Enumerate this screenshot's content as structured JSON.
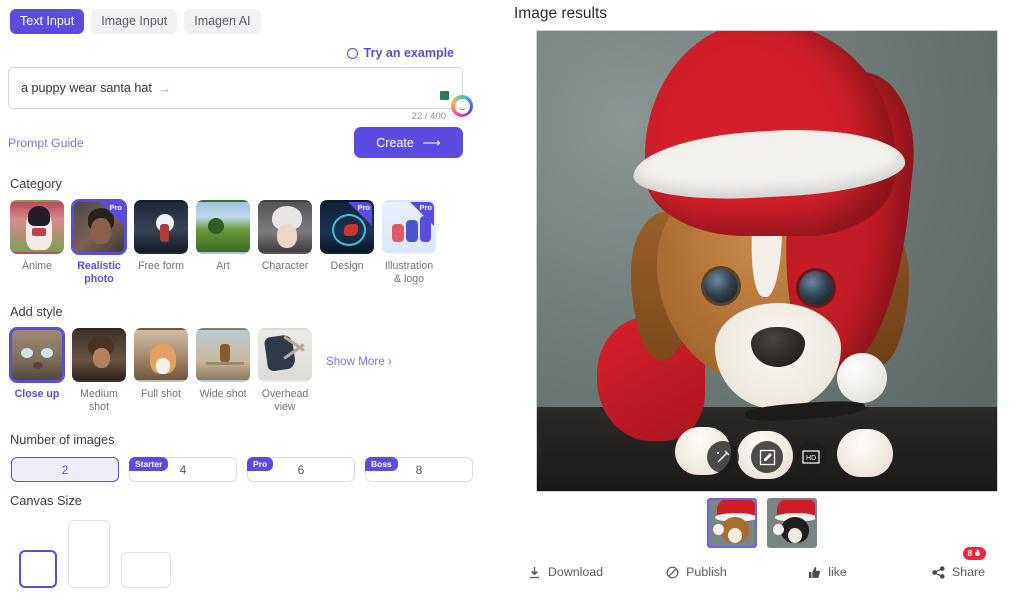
{
  "tabs": [
    {
      "label": "Text Input",
      "active": true
    },
    {
      "label": "Image Input",
      "active": false
    },
    {
      "label": "Imagen AI",
      "active": false
    }
  ],
  "prompt": {
    "try_example": "Try an example",
    "try_example_icon": "refresh-circle-icon",
    "value": "a puppy wear santa hat",
    "arrow": "→",
    "counter": "22 / 400",
    "guide_link": "Prompt Guide",
    "create_label": "Create",
    "create_arrow": "⟶"
  },
  "category": {
    "title": "Category",
    "items": [
      {
        "label": "Anime",
        "pro": false,
        "selected": false
      },
      {
        "label": "Realistic photo",
        "pro": true,
        "selected": true
      },
      {
        "label": "Free form",
        "pro": false,
        "selected": false
      },
      {
        "label": "Art",
        "pro": false,
        "selected": false
      },
      {
        "label": "Character",
        "pro": false,
        "selected": false
      },
      {
        "label": "Design",
        "pro": true,
        "selected": false
      },
      {
        "label": "Illustration & logo",
        "pro": true,
        "selected": false
      }
    ],
    "pro_tag": "Pro"
  },
  "style": {
    "title": "Add style",
    "items": [
      {
        "label": "Close up",
        "selected": true
      },
      {
        "label": "Medium shot",
        "selected": false
      },
      {
        "label": "Full shot",
        "selected": false
      },
      {
        "label": "Wide shot",
        "selected": false
      },
      {
        "label": "Overhead view",
        "selected": false
      }
    ],
    "show_more": "Show More ›"
  },
  "number_of_images": {
    "title": "Number of images",
    "options": [
      {
        "value": "2",
        "tier": "",
        "selected": true
      },
      {
        "value": "4",
        "tier": "Starter",
        "selected": false
      },
      {
        "value": "6",
        "tier": "Pro",
        "selected": false
      },
      {
        "value": "8",
        "tier": "Boss",
        "selected": false
      }
    ]
  },
  "canvas_size": {
    "title": "Canvas Size",
    "options": [
      {
        "name": "square",
        "selected": true
      },
      {
        "name": "portrait",
        "selected": false
      },
      {
        "name": "landscape",
        "selected": false
      }
    ]
  },
  "results": {
    "title": "Image results",
    "tools": [
      {
        "name": "magic-wand-icon"
      },
      {
        "name": "edit-icon"
      },
      {
        "name": "hd-icon",
        "label": "HD"
      }
    ],
    "thumbnails": [
      {
        "name": "result-thumbnail-1",
        "selected": true
      },
      {
        "name": "result-thumbnail-2",
        "selected": false
      }
    ],
    "actions": [
      {
        "label": "Download",
        "icon": "download-icon"
      },
      {
        "label": "Publish",
        "icon": "publish-icon"
      },
      {
        "label": "like",
        "icon": "thumbs-up-icon"
      },
      {
        "label": "Share",
        "icon": "share-icon",
        "badge": "8",
        "badge_icon": "fire-icon"
      }
    ]
  },
  "colors": {
    "accent": "#5b4be0",
    "accent_light": "#eeedfc",
    "link": "#7b74e8",
    "badge_red": "#f5233b",
    "text": "#2b2b33",
    "muted": "#72727e"
  }
}
